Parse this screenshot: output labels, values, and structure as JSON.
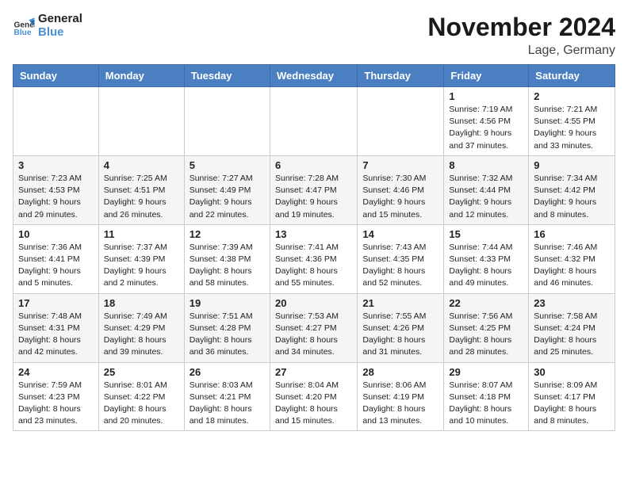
{
  "logo": {
    "line1": "General",
    "line2": "Blue"
  },
  "title": "November 2024",
  "location": "Lage, Germany",
  "headers": [
    "Sunday",
    "Monday",
    "Tuesday",
    "Wednesday",
    "Thursday",
    "Friday",
    "Saturday"
  ],
  "weeks": [
    [
      {
        "day": "",
        "info": ""
      },
      {
        "day": "",
        "info": ""
      },
      {
        "day": "",
        "info": ""
      },
      {
        "day": "",
        "info": ""
      },
      {
        "day": "",
        "info": ""
      },
      {
        "day": "1",
        "info": "Sunrise: 7:19 AM\nSunset: 4:56 PM\nDaylight: 9 hours\nand 37 minutes."
      },
      {
        "day": "2",
        "info": "Sunrise: 7:21 AM\nSunset: 4:55 PM\nDaylight: 9 hours\nand 33 minutes."
      }
    ],
    [
      {
        "day": "3",
        "info": "Sunrise: 7:23 AM\nSunset: 4:53 PM\nDaylight: 9 hours\nand 29 minutes."
      },
      {
        "day": "4",
        "info": "Sunrise: 7:25 AM\nSunset: 4:51 PM\nDaylight: 9 hours\nand 26 minutes."
      },
      {
        "day": "5",
        "info": "Sunrise: 7:27 AM\nSunset: 4:49 PM\nDaylight: 9 hours\nand 22 minutes."
      },
      {
        "day": "6",
        "info": "Sunrise: 7:28 AM\nSunset: 4:47 PM\nDaylight: 9 hours\nand 19 minutes."
      },
      {
        "day": "7",
        "info": "Sunrise: 7:30 AM\nSunset: 4:46 PM\nDaylight: 9 hours\nand 15 minutes."
      },
      {
        "day": "8",
        "info": "Sunrise: 7:32 AM\nSunset: 4:44 PM\nDaylight: 9 hours\nand 12 minutes."
      },
      {
        "day": "9",
        "info": "Sunrise: 7:34 AM\nSunset: 4:42 PM\nDaylight: 9 hours\nand 8 minutes."
      }
    ],
    [
      {
        "day": "10",
        "info": "Sunrise: 7:36 AM\nSunset: 4:41 PM\nDaylight: 9 hours\nand 5 minutes."
      },
      {
        "day": "11",
        "info": "Sunrise: 7:37 AM\nSunset: 4:39 PM\nDaylight: 9 hours\nand 2 minutes."
      },
      {
        "day": "12",
        "info": "Sunrise: 7:39 AM\nSunset: 4:38 PM\nDaylight: 8 hours\nand 58 minutes."
      },
      {
        "day": "13",
        "info": "Sunrise: 7:41 AM\nSunset: 4:36 PM\nDaylight: 8 hours\nand 55 minutes."
      },
      {
        "day": "14",
        "info": "Sunrise: 7:43 AM\nSunset: 4:35 PM\nDaylight: 8 hours\nand 52 minutes."
      },
      {
        "day": "15",
        "info": "Sunrise: 7:44 AM\nSunset: 4:33 PM\nDaylight: 8 hours\nand 49 minutes."
      },
      {
        "day": "16",
        "info": "Sunrise: 7:46 AM\nSunset: 4:32 PM\nDaylight: 8 hours\nand 46 minutes."
      }
    ],
    [
      {
        "day": "17",
        "info": "Sunrise: 7:48 AM\nSunset: 4:31 PM\nDaylight: 8 hours\nand 42 minutes."
      },
      {
        "day": "18",
        "info": "Sunrise: 7:49 AM\nSunset: 4:29 PM\nDaylight: 8 hours\nand 39 minutes."
      },
      {
        "day": "19",
        "info": "Sunrise: 7:51 AM\nSunset: 4:28 PM\nDaylight: 8 hours\nand 36 minutes."
      },
      {
        "day": "20",
        "info": "Sunrise: 7:53 AM\nSunset: 4:27 PM\nDaylight: 8 hours\nand 34 minutes."
      },
      {
        "day": "21",
        "info": "Sunrise: 7:55 AM\nSunset: 4:26 PM\nDaylight: 8 hours\nand 31 minutes."
      },
      {
        "day": "22",
        "info": "Sunrise: 7:56 AM\nSunset: 4:25 PM\nDaylight: 8 hours\nand 28 minutes."
      },
      {
        "day": "23",
        "info": "Sunrise: 7:58 AM\nSunset: 4:24 PM\nDaylight: 8 hours\nand 25 minutes."
      }
    ],
    [
      {
        "day": "24",
        "info": "Sunrise: 7:59 AM\nSunset: 4:23 PM\nDaylight: 8 hours\nand 23 minutes."
      },
      {
        "day": "25",
        "info": "Sunrise: 8:01 AM\nSunset: 4:22 PM\nDaylight: 8 hours\nand 20 minutes."
      },
      {
        "day": "26",
        "info": "Sunrise: 8:03 AM\nSunset: 4:21 PM\nDaylight: 8 hours\nand 18 minutes."
      },
      {
        "day": "27",
        "info": "Sunrise: 8:04 AM\nSunset: 4:20 PM\nDaylight: 8 hours\nand 15 minutes."
      },
      {
        "day": "28",
        "info": "Sunrise: 8:06 AM\nSunset: 4:19 PM\nDaylight: 8 hours\nand 13 minutes."
      },
      {
        "day": "29",
        "info": "Sunrise: 8:07 AM\nSunset: 4:18 PM\nDaylight: 8 hours\nand 10 minutes."
      },
      {
        "day": "30",
        "info": "Sunrise: 8:09 AM\nSunset: 4:17 PM\nDaylight: 8 hours\nand 8 minutes."
      }
    ]
  ]
}
